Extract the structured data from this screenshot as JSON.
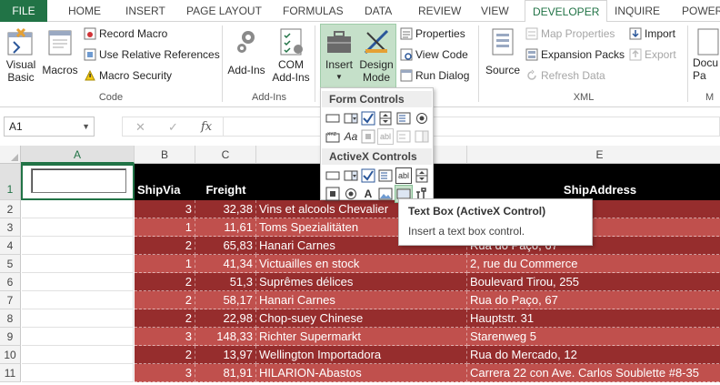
{
  "tabs": {
    "file": "FILE",
    "home": "HOME",
    "insert": "INSERT",
    "page_layout": "PAGE LAYOUT",
    "formulas": "FORMULAS",
    "data": "DATA",
    "review": "REVIEW",
    "view": "VIEW",
    "developer": "DEVELOPER",
    "inquire": "INQUIRE",
    "power": "POWER"
  },
  "ribbon": {
    "code": {
      "visual_basic_line1": "Visual",
      "visual_basic_line2": "Basic",
      "macros": "Macros",
      "record_macro": "Record Macro",
      "relative_refs": "Use Relative References",
      "macro_security": "Macro Security",
      "group": "Code"
    },
    "addins": {
      "addins": "Add-Ins",
      "com_line1": "COM",
      "com_line2": "Add-Ins",
      "group": "Add-Ins"
    },
    "controls": {
      "insert": "Insert",
      "design_line1": "Design",
      "design_line2": "Mode",
      "properties": "Properties",
      "view_code": "View Code",
      "run_dialog": "Run Dialog"
    },
    "xml": {
      "source": "Source",
      "map_properties": "Map Properties",
      "expansion_packs": "Expansion Packs",
      "refresh_data": "Refresh Data",
      "import": "Import",
      "export": "Export",
      "group": "XML"
    },
    "modify": {
      "doc_line1": "Docu",
      "doc_line2": "Pa",
      "group": "M"
    }
  },
  "formula_bar": {
    "name_box": "A1",
    "cancel_glyph": "✕",
    "enter_glyph": "✓",
    "fx_glyph": "fx",
    "formula": ""
  },
  "dropdown": {
    "form_controls": "Form Controls",
    "activex_controls": "ActiveX Controls",
    "abl_label": "abl",
    "aa_label": "Aa",
    "xyz_label": "XYZ",
    "a_label": "A"
  },
  "tooltip": {
    "title": "Text Box (ActiveX Control)",
    "description": "Insert a text box control."
  },
  "columns": [
    "A",
    "B",
    "C",
    "E"
  ],
  "rows": [
    "1",
    "2",
    "3",
    "4",
    "5",
    "6",
    "7",
    "8",
    "9",
    "10",
    "11"
  ],
  "sheet_header": {
    "shipvia": "ShipVia",
    "freight": "Freight",
    "shipaddress": "ShipAddress"
  },
  "data_rows": [
    {
      "shipvia": "3",
      "freight": "32,38",
      "shipname": "Vins et alcools Chevalier",
      "address": ""
    },
    {
      "shipvia": "1",
      "freight": "11,61",
      "shipname": "Toms Spezialitäten",
      "address": ""
    },
    {
      "shipvia": "2",
      "freight": "65,83",
      "shipname": "Hanari Carnes",
      "address": "Rua do Paço, 67"
    },
    {
      "shipvia": "1",
      "freight": "41,34",
      "shipname": "Victuailles en stock",
      "address": "2, rue du Commerce"
    },
    {
      "shipvia": "2",
      "freight": "51,3",
      "shipname": "Suprêmes délices",
      "address": "Boulevard Tirou, 255"
    },
    {
      "shipvia": "2",
      "freight": "58,17",
      "shipname": "Hanari Carnes",
      "address": "Rua do Paço, 67"
    },
    {
      "shipvia": "2",
      "freight": "22,98",
      "shipname": "Chop-suey Chinese",
      "address": "Hauptstr. 31"
    },
    {
      "shipvia": "3",
      "freight": "148,33",
      "shipname": "Richter Supermarkt",
      "address": "Starenweg 5"
    },
    {
      "shipvia": "2",
      "freight": "13,97",
      "shipname": "Wellington Importadora",
      "address": "Rua do Mercado, 12"
    },
    {
      "shipvia": "3",
      "freight": "81,91",
      "shipname": "HILARION-Abastos",
      "address": "Carrera 22 con Ave. Carlos Soublette #8-35"
    }
  ],
  "colors": {
    "accent": "#217346",
    "row_light": "#c0504d",
    "row_dark": "#962d2d",
    "header_bg": "#000000",
    "highlight": "#c5e0c9"
  }
}
